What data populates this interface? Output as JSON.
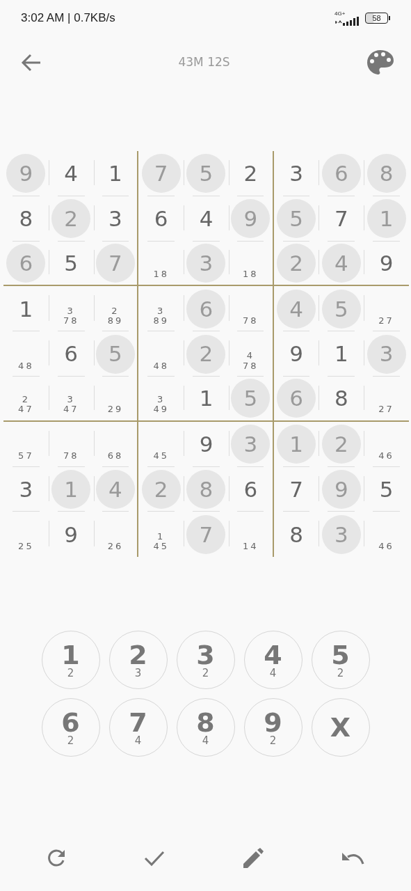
{
  "status_bar": {
    "time_speed": "3:02 AM | 0.7KB/s",
    "network": "4G+",
    "battery": "58"
  },
  "header": {
    "timer": "43M 12S"
  },
  "board": {
    "rows": [
      [
        {
          "kind": "given",
          "value": "9"
        },
        {
          "kind": "filled",
          "value": "4"
        },
        {
          "kind": "filled",
          "value": "1"
        },
        {
          "kind": "given",
          "value": "7"
        },
        {
          "kind": "given",
          "value": "5"
        },
        {
          "kind": "filled",
          "value": "2"
        },
        {
          "kind": "filled",
          "value": "3"
        },
        {
          "kind": "given",
          "value": "6"
        },
        {
          "kind": "given",
          "value": "8"
        }
      ],
      [
        {
          "kind": "filled",
          "value": "8"
        },
        {
          "kind": "given",
          "value": "2"
        },
        {
          "kind": "filled",
          "value": "3"
        },
        {
          "kind": "filled",
          "value": "6"
        },
        {
          "kind": "filled",
          "value": "4"
        },
        {
          "kind": "given",
          "value": "9"
        },
        {
          "kind": "given",
          "value": "5"
        },
        {
          "kind": "filled",
          "value": "7"
        },
        {
          "kind": "given",
          "value": "1"
        }
      ],
      [
        {
          "kind": "given",
          "value": "6"
        },
        {
          "kind": "filled",
          "value": "5"
        },
        {
          "kind": "given",
          "value": "7"
        },
        {
          "kind": "notes",
          "notes": [
            "18"
          ]
        },
        {
          "kind": "given",
          "value": "3"
        },
        {
          "kind": "notes",
          "notes": [
            "18"
          ]
        },
        {
          "kind": "given",
          "value": "2"
        },
        {
          "kind": "given",
          "value": "4"
        },
        {
          "kind": "filled",
          "value": "9"
        }
      ],
      [
        {
          "kind": "filled",
          "value": "1"
        },
        {
          "kind": "notes",
          "notes": [
            "3",
            "78"
          ]
        },
        {
          "kind": "notes",
          "notes": [
            "2",
            "89"
          ]
        },
        {
          "kind": "notes",
          "notes": [
            "3",
            "89"
          ]
        },
        {
          "kind": "given",
          "value": "6"
        },
        {
          "kind": "notes",
          "notes": [
            "78"
          ]
        },
        {
          "kind": "given",
          "value": "4"
        },
        {
          "kind": "given",
          "value": "5"
        },
        {
          "kind": "notes",
          "notes": [
            "27"
          ]
        }
      ],
      [
        {
          "kind": "notes",
          "notes": [
            "48"
          ]
        },
        {
          "kind": "filled",
          "value": "6"
        },
        {
          "kind": "given",
          "value": "5"
        },
        {
          "kind": "notes",
          "notes": [
            "48"
          ]
        },
        {
          "kind": "given",
          "value": "2"
        },
        {
          "kind": "notes",
          "notes": [
            "4",
            "78"
          ]
        },
        {
          "kind": "filled",
          "value": "9"
        },
        {
          "kind": "filled",
          "value": "1"
        },
        {
          "kind": "given",
          "value": "3"
        }
      ],
      [
        {
          "kind": "notes",
          "notes": [
            "2",
            "47"
          ]
        },
        {
          "kind": "notes",
          "notes": [
            "3",
            "47"
          ]
        },
        {
          "kind": "notes",
          "notes": [
            "29"
          ]
        },
        {
          "kind": "notes",
          "notes": [
            "3",
            "49"
          ]
        },
        {
          "kind": "filled",
          "value": "1"
        },
        {
          "kind": "given",
          "value": "5"
        },
        {
          "kind": "given",
          "value": "6"
        },
        {
          "kind": "filled",
          "value": "8"
        },
        {
          "kind": "notes",
          "notes": [
            "27"
          ]
        }
      ],
      [
        {
          "kind": "notes",
          "notes": [
            "57"
          ]
        },
        {
          "kind": "notes",
          "notes": [
            "78"
          ]
        },
        {
          "kind": "notes",
          "notes": [
            "68"
          ]
        },
        {
          "kind": "notes",
          "notes": [
            "45"
          ]
        },
        {
          "kind": "filled",
          "value": "9"
        },
        {
          "kind": "given",
          "value": "3"
        },
        {
          "kind": "given",
          "value": "1"
        },
        {
          "kind": "given",
          "value": "2"
        },
        {
          "kind": "notes",
          "notes": [
            "46"
          ]
        }
      ],
      [
        {
          "kind": "filled",
          "value": "3"
        },
        {
          "kind": "given",
          "value": "1"
        },
        {
          "kind": "given",
          "value": "4"
        },
        {
          "kind": "given",
          "value": "2"
        },
        {
          "kind": "given",
          "value": "8"
        },
        {
          "kind": "filled",
          "value": "6"
        },
        {
          "kind": "filled",
          "value": "7"
        },
        {
          "kind": "given",
          "value": "9"
        },
        {
          "kind": "filled",
          "value": "5"
        }
      ],
      [
        {
          "kind": "notes",
          "notes": [
            "25"
          ]
        },
        {
          "kind": "filled",
          "value": "9"
        },
        {
          "kind": "notes",
          "notes": [
            "26"
          ]
        },
        {
          "kind": "notes",
          "notes": [
            "1",
            "45"
          ]
        },
        {
          "kind": "given",
          "value": "7"
        },
        {
          "kind": "notes",
          "notes": [
            "14"
          ]
        },
        {
          "kind": "filled",
          "value": "8"
        },
        {
          "kind": "given",
          "value": "3"
        },
        {
          "kind": "notes",
          "notes": [
            "46"
          ]
        }
      ]
    ]
  },
  "number_pad": [
    {
      "digit": "1",
      "count": "2"
    },
    {
      "digit": "2",
      "count": "3"
    },
    {
      "digit": "3",
      "count": "2"
    },
    {
      "digit": "4",
      "count": "4"
    },
    {
      "digit": "5",
      "count": "2"
    },
    {
      "digit": "6",
      "count": "2"
    },
    {
      "digit": "7",
      "count": "4"
    },
    {
      "digit": "8",
      "count": "4"
    },
    {
      "digit": "9",
      "count": "2"
    },
    {
      "digit": "X"
    }
  ]
}
